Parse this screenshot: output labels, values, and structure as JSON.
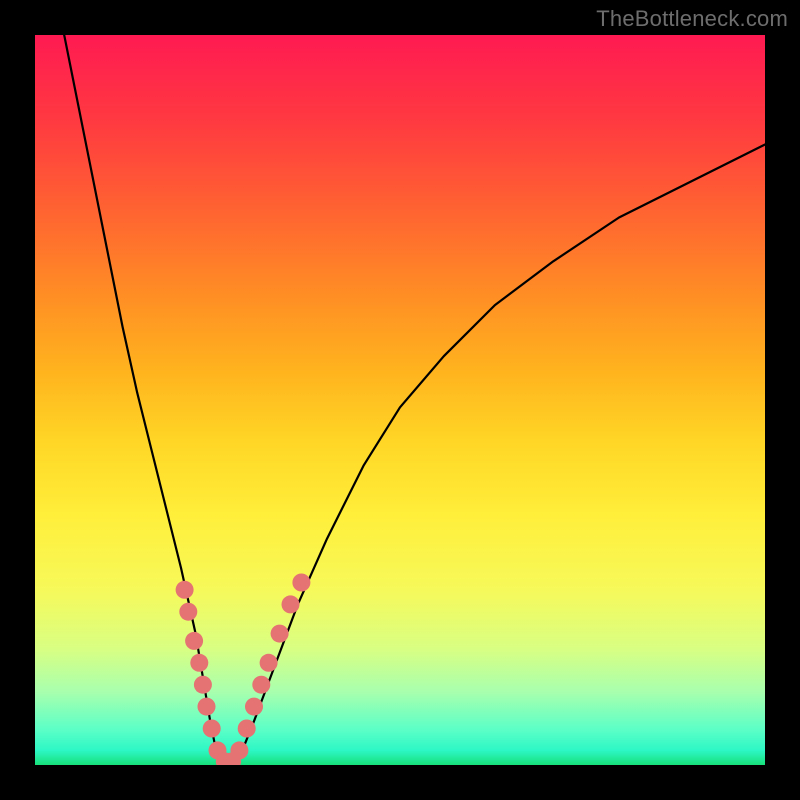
{
  "watermark": "TheBottleneck.com",
  "chart_data": {
    "type": "line",
    "title": "",
    "xlabel": "",
    "ylabel": "",
    "xlim": [
      0,
      100
    ],
    "ylim": [
      0,
      100
    ],
    "grid": false,
    "legend": false,
    "annotations": [],
    "series": [
      {
        "name": "bottleneck-curve",
        "color": "#000000",
        "x": [
          4,
          6,
          8,
          10,
          12,
          14,
          16,
          18,
          20,
          22,
          23,
          24,
          25,
          26,
          27,
          28,
          30,
          33,
          36,
          40,
          45,
          50,
          56,
          63,
          71,
          80,
          90,
          100
        ],
        "y": [
          100,
          90,
          80,
          70,
          60,
          51,
          43,
          35,
          27,
          18,
          12,
          6,
          1,
          0,
          0,
          1,
          6,
          14,
          22,
          31,
          41,
          49,
          56,
          63,
          69,
          75,
          80,
          85
        ]
      }
    ],
    "markers": {
      "name": "highlighted-points",
      "color": "#e57373",
      "points": [
        {
          "x": 20.5,
          "y": 24
        },
        {
          "x": 21.0,
          "y": 21
        },
        {
          "x": 21.8,
          "y": 17
        },
        {
          "x": 22.5,
          "y": 14
        },
        {
          "x": 23.0,
          "y": 11
        },
        {
          "x": 23.5,
          "y": 8
        },
        {
          "x": 24.2,
          "y": 5
        },
        {
          "x": 25.0,
          "y": 2
        },
        {
          "x": 26.0,
          "y": 0.5
        },
        {
          "x": 27.0,
          "y": 0.5
        },
        {
          "x": 28.0,
          "y": 2
        },
        {
          "x": 29.0,
          "y": 5
        },
        {
          "x": 30.0,
          "y": 8
        },
        {
          "x": 31.0,
          "y": 11
        },
        {
          "x": 32.0,
          "y": 14
        },
        {
          "x": 33.5,
          "y": 18
        },
        {
          "x": 35.0,
          "y": 22
        },
        {
          "x": 36.5,
          "y": 25
        }
      ]
    },
    "gradient_stops": [
      {
        "pos": 0,
        "color": "#ff1a52"
      },
      {
        "pos": 12,
        "color": "#ff3a40"
      },
      {
        "pos": 26,
        "color": "#ff6a2f"
      },
      {
        "pos": 36,
        "color": "#ff8f24"
      },
      {
        "pos": 46,
        "color": "#ffb31e"
      },
      {
        "pos": 56,
        "color": "#ffd726"
      },
      {
        "pos": 66,
        "color": "#ffef3b"
      },
      {
        "pos": 76,
        "color": "#f6f95a"
      },
      {
        "pos": 84,
        "color": "#d9ff82"
      },
      {
        "pos": 90,
        "color": "#a8ffae"
      },
      {
        "pos": 95,
        "color": "#5effc6"
      },
      {
        "pos": 98,
        "color": "#2df7c5"
      },
      {
        "pos": 100,
        "color": "#17e07a"
      }
    ]
  }
}
